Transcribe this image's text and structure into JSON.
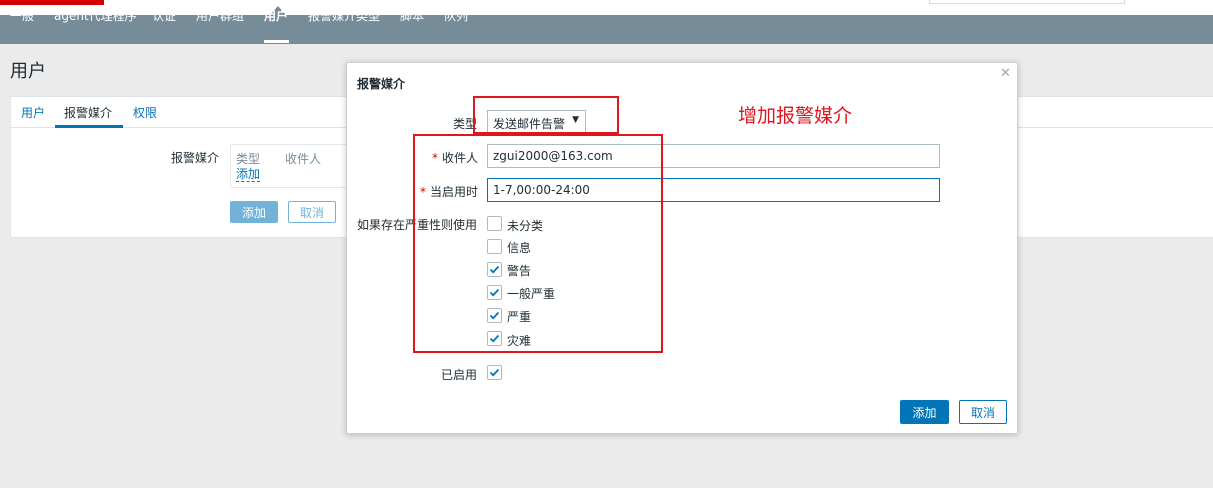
{
  "nav": {
    "items": [
      "一般",
      "agent代理程序",
      "认证",
      "用户群组",
      "用户",
      "报警媒介类型",
      "脚本",
      "队列"
    ],
    "active": "用户"
  },
  "page": {
    "title": "用户",
    "tabs": [
      "用户",
      "报警媒介",
      "权限"
    ],
    "active_tab": "报警媒介",
    "media_label": "报警媒介",
    "table_headers": [
      "类型",
      "收件人"
    ],
    "add_link": "添加",
    "add_button": "添加",
    "cancel_button": "取消"
  },
  "modal": {
    "title": "报警媒介",
    "close_icon": "close-icon",
    "type_label": "类型",
    "type_value": "发送邮件告警",
    "recipient_label": "收件人",
    "recipient_value": "zgui2000@163.com",
    "when_active_label": "当启用时",
    "when_active_value": "1-7,00:00-24:00",
    "severity_label": "如果存在严重性则使用",
    "severities": [
      {
        "label": "未分类",
        "checked": false
      },
      {
        "label": "信息",
        "checked": false
      },
      {
        "label": "警告",
        "checked": true
      },
      {
        "label": "一般严重",
        "checked": true
      },
      {
        "label": "严重",
        "checked": true
      },
      {
        "label": "灾难",
        "checked": true
      }
    ],
    "enabled_label": "已启用",
    "enabled_checked": true,
    "add_button": "添加",
    "cancel_button": "取消"
  },
  "annotation": {
    "note": "增加报警媒介",
    "color": "#e0151f"
  },
  "colors": {
    "nav_bg": "#768d99",
    "primary": "#0275b8",
    "required": "#d40000"
  }
}
